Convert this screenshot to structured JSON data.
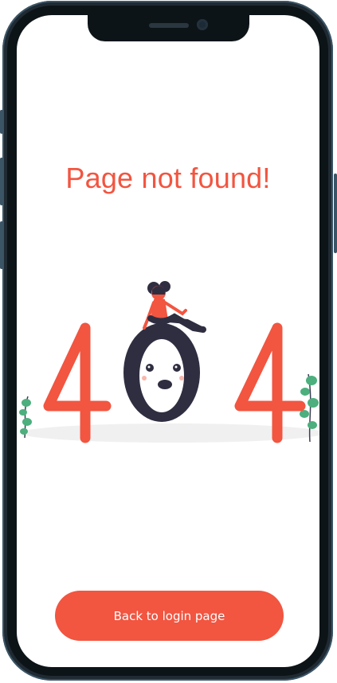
{
  "page": {
    "title": "Page not found!"
  },
  "illustration": {
    "code_text": "404"
  },
  "actions": {
    "back_button_label": "Back to login page"
  },
  "colors": {
    "accent": "#f25540",
    "dark": "#2f2e41",
    "leaf": "#4caf7d",
    "frame": "#1f2a33"
  }
}
